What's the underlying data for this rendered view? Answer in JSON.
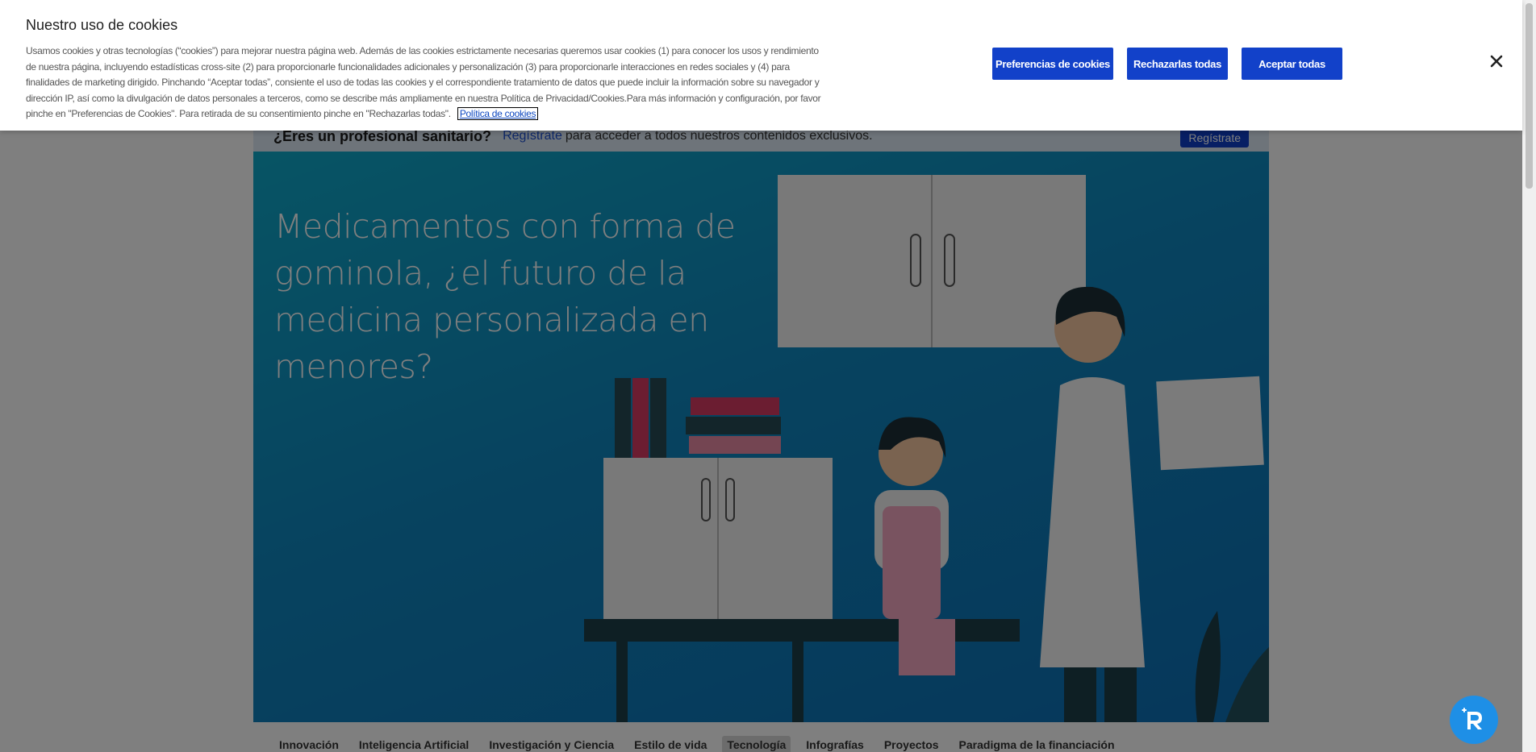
{
  "cookie_banner": {
    "title": "Nuestro uso de cookies",
    "text": "Usamos cookies y otras tecnologías (“cookies”) para mejorar nuestra página web. Además de las cookies estrictamente necesarias queremos usar cookies (1) para conocer los usos y rendimiento de nuestra página, incluyendo estadísticas cross-site (2) para proporcionarle funcionalidades adicionales y personalización (3) para proporcionarle interacciones en redes sociales y (4) para finalidades de marketing dirigido. Pinchando “Aceptar todas”, consiente el uso de todas las cookies y el correspondiente tratamiento de datos que puede incluir la información sobre su navegador y dirección IP, así como la divulgación de datos personales a terceros, como se describe más ampliamente en nuestra Política de Privacidad/Cookies.Para más información y configuración, por favor pinche en \"Preferencias de Cookies\". Para retirada de su consentimiento pinche en \"Rechazarlas todas\".",
    "policy_link": "Política de cookies",
    "btn_preferences": "Preferencias de cookies",
    "btn_reject": "Rechazarlas todas",
    "btn_accept": "Aceptar todas",
    "close_icon": "close-icon"
  },
  "pro_bar": {
    "question": "¿Eres un profesional sanitario?",
    "link": "Regístrate",
    "text": "para acceder a todos nuestros contenidos exclusivos.",
    "button": "Regístrate"
  },
  "hero": {
    "title": "Medicamentos con forma de gominola, ¿el futuro de la medicina personalizada en menores?"
  },
  "nav": {
    "items": [
      "Innovación",
      "Inteligencia Artificial",
      "Investigación y Ciencia",
      "Estilo de vida",
      "Tecnología",
      "Infografías",
      "Proyectos",
      "Paradigma de la financiación"
    ],
    "active": "Tecnología"
  },
  "colors": {
    "accent": "#1241c9",
    "hero_bg": "#0f86bf",
    "fab": "#1e8fe6"
  }
}
